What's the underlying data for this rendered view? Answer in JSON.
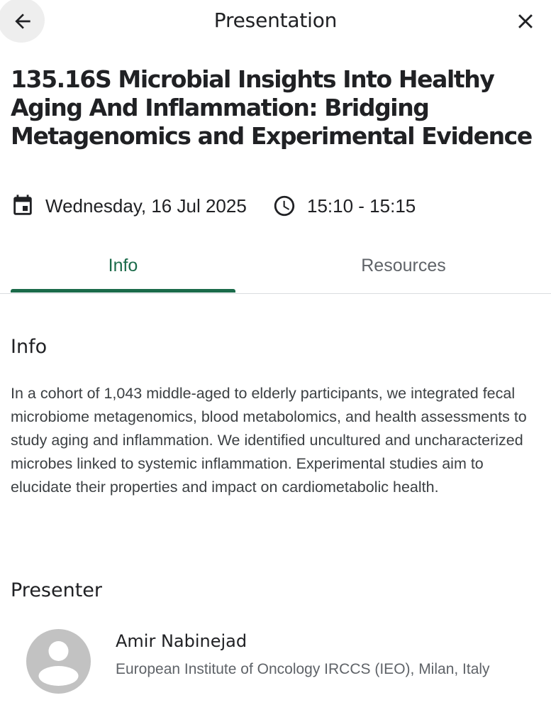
{
  "header": {
    "title": "Presentation",
    "back_icon": "arrow-left-icon",
    "close_icon": "close-icon"
  },
  "presentation": {
    "title": "135.16S Microbial Insights Into Healthy Aging And Inflammation: Bridging Metagenomics and Experimental Evidence",
    "date": "Wednesday, 16 Jul 2025",
    "time": "15:10 - 15:15",
    "date_icon": "calendar-icon",
    "time_icon": "clock-icon"
  },
  "tabs": [
    {
      "label": "Info",
      "active": true
    },
    {
      "label": "Resources",
      "active": false
    }
  ],
  "info": {
    "heading": "Info",
    "body": "In a cohort of 1,043 middle-aged to elderly participants, we integrated fecal microbiome metagenomics, blood metabolomics, and health assessments to study aging and inflammation. We identified uncultured and uncharacterized microbes linked to systemic inflammation. Experimental studies aim to elucidate their properties and impact on cardiometabolic health."
  },
  "presenter": {
    "heading": "Presenter",
    "name": "Amir Nabinejad",
    "affiliation": "European Institute of Oncology IRCCS (IEO), Milan, Italy",
    "avatar_icon": "person-avatar-icon"
  },
  "colors": {
    "accent": "#1b6b4a",
    "text_primary": "#202124",
    "text_secondary": "#5f6368",
    "avatar_bg": "#c2c2c2"
  }
}
